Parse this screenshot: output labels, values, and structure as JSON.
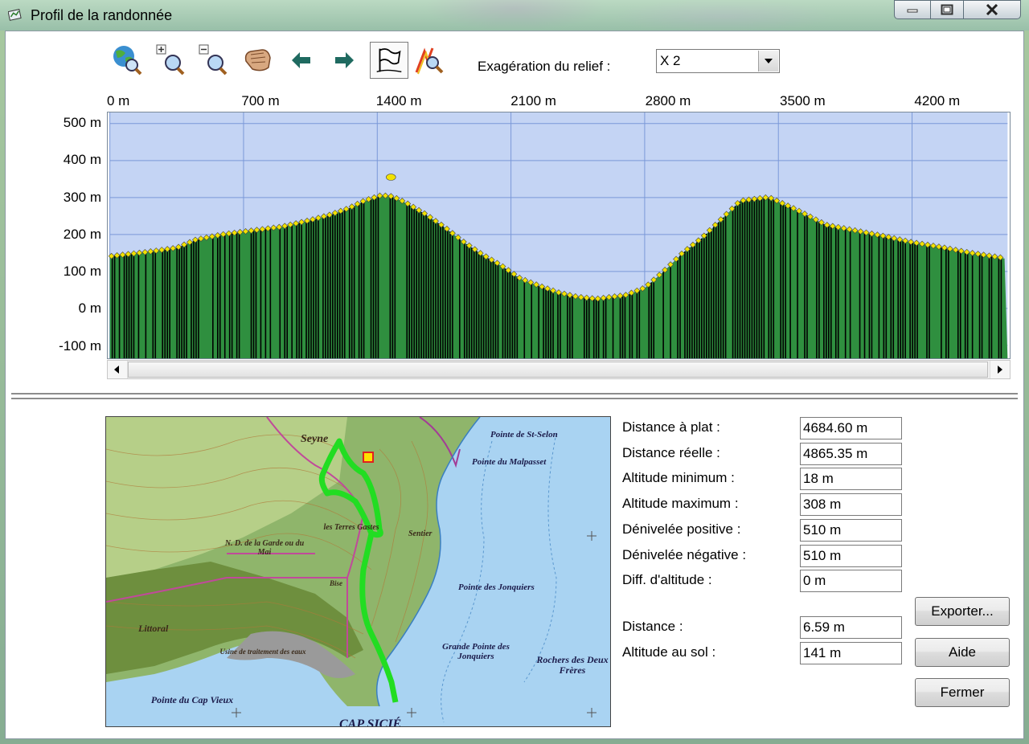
{
  "window": {
    "title": "Profil de la randonnée"
  },
  "toolbar": {
    "tools": [
      {
        "icon": "globe-zoom-icon"
      },
      {
        "icon": "zoom-in-icon"
      },
      {
        "icon": "zoom-out-icon"
      },
      {
        "icon": "pan-hand-icon"
      },
      {
        "icon": "arrow-left-icon"
      },
      {
        "icon": "arrow-right-icon"
      },
      {
        "icon": "flag-icon",
        "active": true
      },
      {
        "icon": "profile-zoom-icon"
      }
    ],
    "exaggeration_label": "Exagération du relief :",
    "exaggeration_value": "X 2"
  },
  "colors": {
    "plot_background": "#c4d4f4",
    "grid": "#7a98d8",
    "fill_green": "#2f8f3f",
    "fill_dark": "#000000",
    "marker": "#f2e200"
  },
  "chart_data": {
    "type": "area",
    "xlabel": "",
    "ylabel": "",
    "x_ticks": [
      "0 m",
      "700 m",
      "1400 m",
      "2100 m",
      "2800 m",
      "3500 m",
      "4200 m"
    ],
    "y_ticks": [
      "500 m",
      "400 m",
      "300 m",
      "200 m",
      "100 m",
      "0 m",
      "-100 m"
    ],
    "xlim": [
      0,
      4700
    ],
    "ylim": [
      -135,
      530
    ],
    "grid": true,
    "series": [
      {
        "x": [
          0,
          200,
          350,
          450,
          600,
          750,
          900,
          1050,
          1150,
          1250,
          1330,
          1420,
          1480,
          1550,
          1650,
          1750,
          1850,
          1950,
          2050,
          2150,
          2250,
          2350,
          2450,
          2550,
          2700,
          2800,
          2900,
          3000,
          3100,
          3200,
          3300,
          3450,
          3600,
          3750,
          3900,
          4050,
          4200,
          4350,
          4500,
          4684
        ],
        "y": [
          140,
          152,
          163,
          185,
          200,
          210,
          220,
          238,
          252,
          270,
          290,
          305,
          302,
          285,
          255,
          220,
          180,
          145,
          115,
          80,
          60,
          42,
          30,
          25,
          35,
          55,
          100,
          150,
          190,
          240,
          290,
          300,
          265,
          225,
          210,
          195,
          178,
          165,
          150,
          135
        ]
      }
    ],
    "outliers": [
      {
        "x": 1480,
        "y": 355
      }
    ]
  },
  "map": {
    "labels": [
      "Pointe de St-Selon",
      "Pointe du Malpasset",
      "Pointe des Jonquiers",
      "Grande Pointe des Jonquiers",
      "Rochers des Deux Frères",
      "Pointe du Cap Vieux",
      "CAP SICIÉ",
      "N. D. de la Garde ou du Mai",
      "les Terres Gastes",
      "Littoral",
      "Sentier",
      "Usine de traitement des eaux",
      "Seyne",
      "Bise"
    ]
  },
  "stats": [
    {
      "label": "Distance à plat :",
      "value": "4684.60 m"
    },
    {
      "label": "Distance réelle :",
      "value": "4865.35 m"
    },
    {
      "label": "Altitude minimum :",
      "value": "18 m"
    },
    {
      "label": "Altitude maximum :",
      "value": "308 m"
    },
    {
      "label": "Dénivelée positive :",
      "value": "510 m"
    },
    {
      "label": "Dénivelée négative :",
      "value": "510 m"
    },
    {
      "label": "Diff. d'altitude :",
      "value": "0 m"
    }
  ],
  "cursor": [
    {
      "label": "Distance :",
      "value": "6.59 m"
    },
    {
      "label": "Altitude au sol :",
      "value": "141 m"
    }
  ],
  "buttons": {
    "export": "Exporter...",
    "help": "Aide",
    "close": "Fermer"
  }
}
